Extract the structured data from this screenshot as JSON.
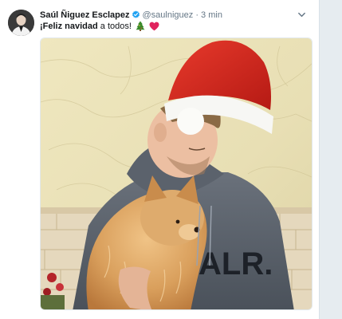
{
  "tweet": {
    "author_name": "Saúl Ñiguez Esclapez",
    "handle": "@saulniguez",
    "separator": "·",
    "time": "3 min",
    "text_prefix": "¡Feliz navidad",
    "text_suffix": " a todos!",
    "emojis": [
      "christmas-tree",
      "red-heart"
    ],
    "media_overlay_text": "ALR."
  },
  "colors": {
    "verified_blue": "#1da1f2",
    "heart_red": "#e0245e",
    "tree_green": "#3a8a2a",
    "hat_red": "#d7261e",
    "sweater_gray": "#5c636d",
    "dog_fur": "#d9a25e"
  }
}
